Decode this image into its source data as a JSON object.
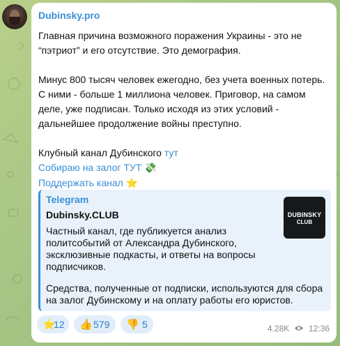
{
  "channel": {
    "name": "Dubinsky.pro"
  },
  "message": {
    "para1": "Главная причина возможного поражения Украины - это не “пэтриот” и его отсутствие. Это демография.",
    "para2": "Минус 800 тысяч человек ежегодно, без учета военных потерь. С ними - больше 1 миллиона человек. Приговор, на самом деле, уже подписан. Только исходя из этих условий - дальнейшее продолжение войны преступно.",
    "club_text": "Клубный канал Дубинского ",
    "club_link": "тут",
    "bail_link": "Собираю на залог ТУТ",
    "bail_emoji": "💸",
    "support_link": "Поддержать канал",
    "support_emoji": "⭐"
  },
  "preview": {
    "source": "Telegram",
    "title": "Dubinsky.CLUB",
    "body": "Частный канал, где публикуется анализ политсобытий от Александра Дубинского, эксклюзивные подкасты, и ответы на вопросы подписчиков.",
    "body2": "Средства, полученные от подписки, используются для сбора на залог Дубинскому и на оплату работы его юристов.",
    "thumb_line1": "DUBINSKY",
    "thumb_line2": "CLUB"
  },
  "reactions": [
    {
      "emoji": "⭐",
      "count": "12",
      "icon": "star-icon"
    },
    {
      "emoji": "👍",
      "count": "579",
      "icon": "thumbs-up-icon"
    },
    {
      "emoji": "👎",
      "count": "5",
      "icon": "thumbs-down-icon"
    }
  ],
  "meta": {
    "views": "4.28K",
    "time": "12:36"
  },
  "colors": {
    "accent": "#3a8fd6",
    "preview_bg": "#e9f2fb",
    "reaction_bg": "#e1eefa"
  }
}
